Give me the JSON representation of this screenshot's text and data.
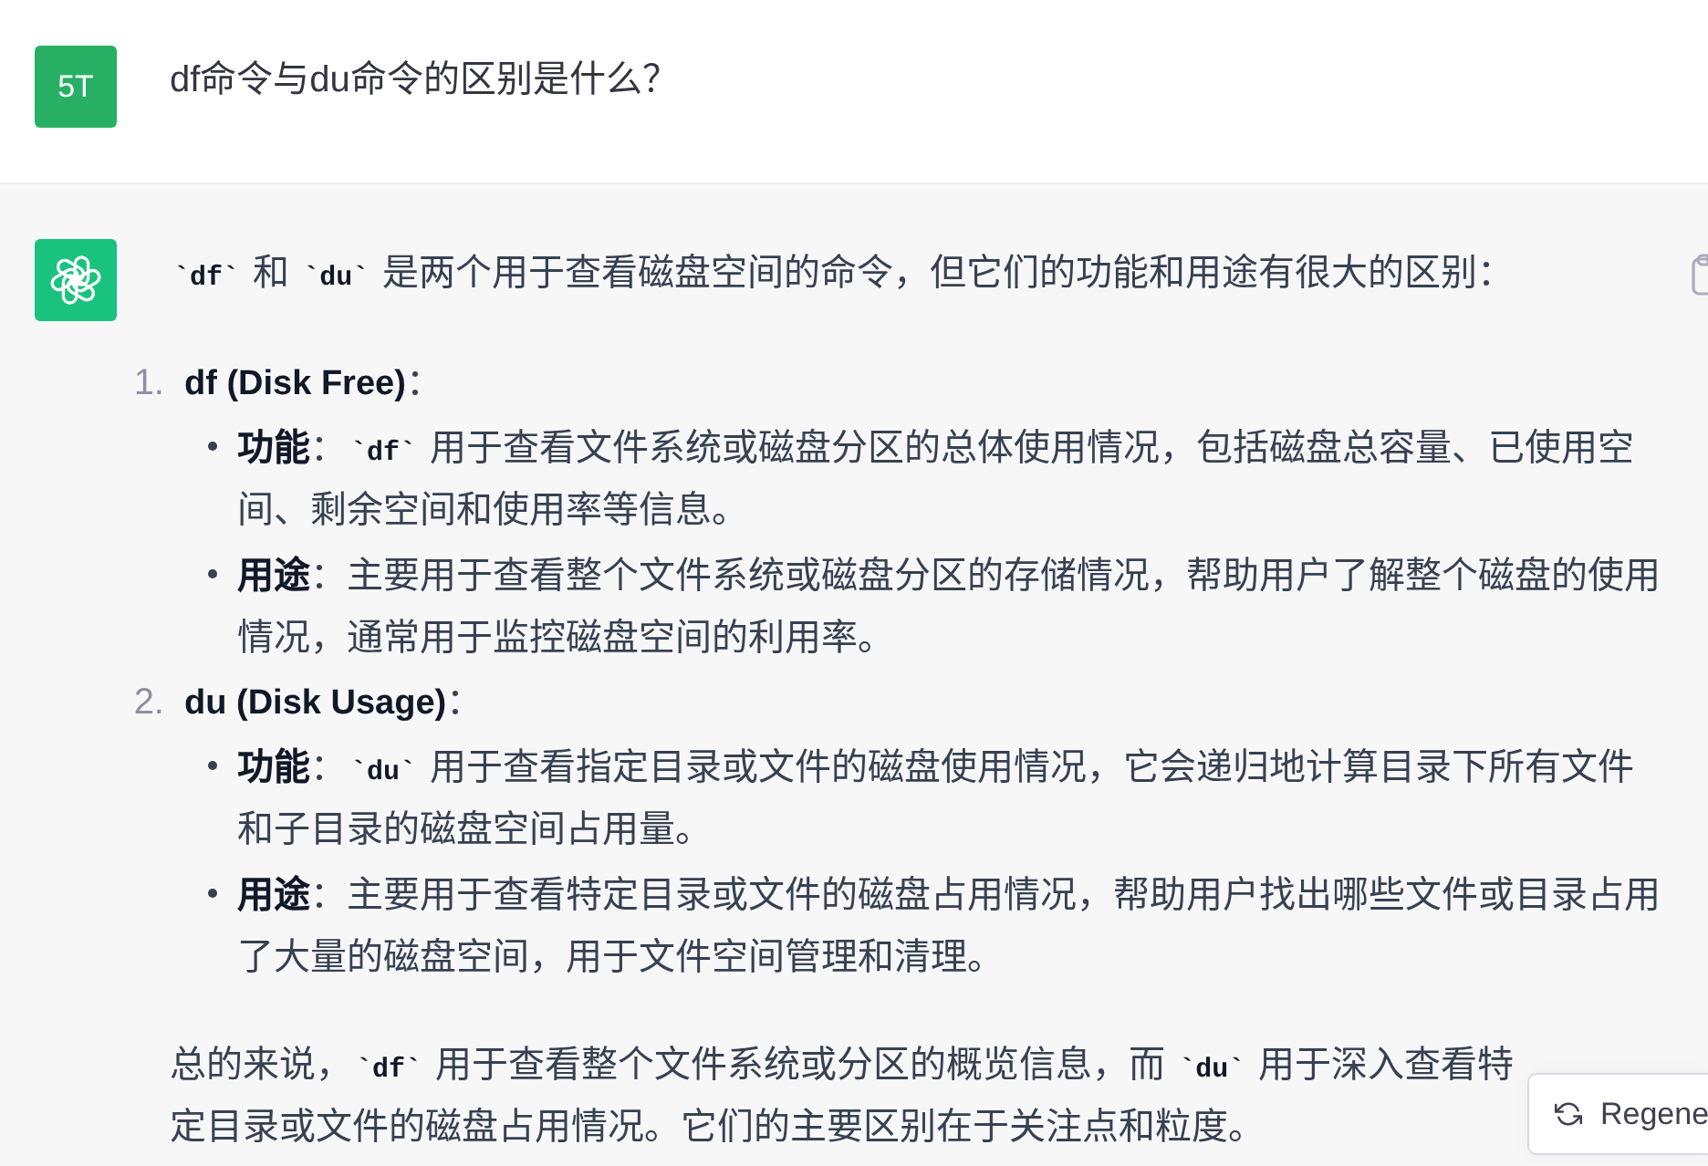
{
  "user_message": {
    "avatar": "5T",
    "text": "df命令与du命令的区别是什么？"
  },
  "assistant_message": {
    "blocks": [
      {
        "kind": "paragraph",
        "segments": [
          {
            "kind": "code",
            "text": "`df`"
          },
          {
            "kind": "text",
            "text": " 和 "
          },
          {
            "kind": "code",
            "text": "`du`"
          },
          {
            "kind": "text",
            "text": " 是两个用于查看磁盘空间的命令，但它们的功能和用途有很大的区别："
          }
        ]
      },
      {
        "kind": "ordered_list",
        "items": [
          {
            "number": "1.",
            "title": [
              {
                "kind": "bold",
                "text": "df (Disk Free)"
              },
              {
                "kind": "text",
                "text": "："
              }
            ],
            "bullets": [
              {
                "segments": [
                  {
                    "kind": "bold",
                    "text": "功能"
                  },
                  {
                    "kind": "text",
                    "text": "："
                  },
                  {
                    "kind": "code",
                    "text": "`df`"
                  },
                  {
                    "kind": "text",
                    "text": " 用于查看文件系统或磁盘分区的总体使用情况，包括磁盘总容量、已使用空间、剩余空间和使用率等信息。"
                  }
                ]
              },
              {
                "segments": [
                  {
                    "kind": "bold",
                    "text": "用途"
                  },
                  {
                    "kind": "text",
                    "text": "：主要用于查看整个文件系统或磁盘分区的存储情况，帮助用户了解整个磁盘的使用情况，通常用于监控磁盘空间的利用率。"
                  }
                ]
              }
            ]
          },
          {
            "number": "2.",
            "title": [
              {
                "kind": "bold",
                "text": "du (Disk Usage)"
              },
              {
                "kind": "text",
                "text": "："
              }
            ],
            "bullets": [
              {
                "segments": [
                  {
                    "kind": "bold",
                    "text": "功能"
                  },
                  {
                    "kind": "text",
                    "text": "："
                  },
                  {
                    "kind": "code",
                    "text": "`du`"
                  },
                  {
                    "kind": "text",
                    "text": " 用于查看指定目录或文件的磁盘使用情况，它会递归地计算目录下所有文件和子目录的磁盘空间占用量。"
                  }
                ]
              },
              {
                "segments": [
                  {
                    "kind": "bold",
                    "text": "用途"
                  },
                  {
                    "kind": "text",
                    "text": "：主要用于查看特定目录或文件的磁盘占用情况，帮助用户找出哪些文件或目录占用了大量的磁盘空间，用于文件空间管理和清理。"
                  }
                ]
              }
            ]
          }
        ]
      },
      {
        "kind": "paragraph",
        "segments": [
          {
            "kind": "text",
            "text": "总的来说，"
          },
          {
            "kind": "code",
            "text": "`df`"
          },
          {
            "kind": "text",
            "text": " 用于查看整个文件系统或分区的概览信息，而 "
          },
          {
            "kind": "code",
            "text": "`du`"
          },
          {
            "kind": "text",
            "text": " 用于深入查看特定目录或文件的磁盘占用情况。它们的主要区别在于关注点和粒度。"
          }
        ]
      }
    ]
  },
  "regenerate_button": {
    "label": "Regene"
  }
}
